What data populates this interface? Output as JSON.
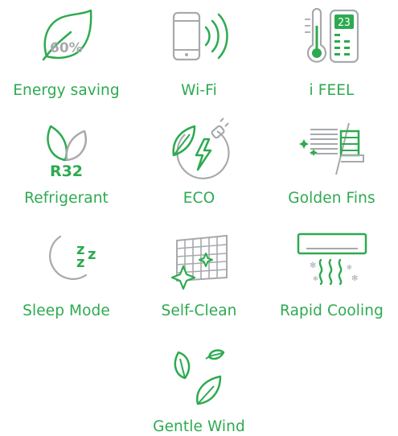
{
  "features": [
    {
      "id": "energy-saving",
      "label": "Energy saving",
      "icon": "leaf-percent-icon",
      "badge": "60%"
    },
    {
      "id": "wifi",
      "label": "Wi-Fi",
      "icon": "phone-signal-icon"
    },
    {
      "id": "ifeel",
      "label": "i FEEL",
      "icon": "thermometer-remote-icon",
      "remote_display": "23"
    },
    {
      "id": "refrigerant",
      "label": "Refrigerant",
      "icon": "leaves-icon",
      "badge": "R32"
    },
    {
      "id": "eco",
      "label": "ECO",
      "icon": "eco-plug-icon"
    },
    {
      "id": "golden-fins",
      "label": "Golden Fins",
      "icon": "fins-icon"
    },
    {
      "id": "sleep-mode",
      "label": "Sleep Mode",
      "icon": "moon-zzz-icon",
      "badge": "Zzz"
    },
    {
      "id": "self-clean",
      "label": "Self-Clean",
      "icon": "grid-sparkle-icon"
    },
    {
      "id": "rapid-cooling",
      "label": "Rapid Cooling",
      "icon": "ac-unit-icon"
    },
    {
      "id": "gentle-wind",
      "label": "Gentle Wind",
      "icon": "leaves-wind-icon"
    }
  ],
  "colors": {
    "green": "#2daa50",
    "gray": "#a7a9ac"
  }
}
